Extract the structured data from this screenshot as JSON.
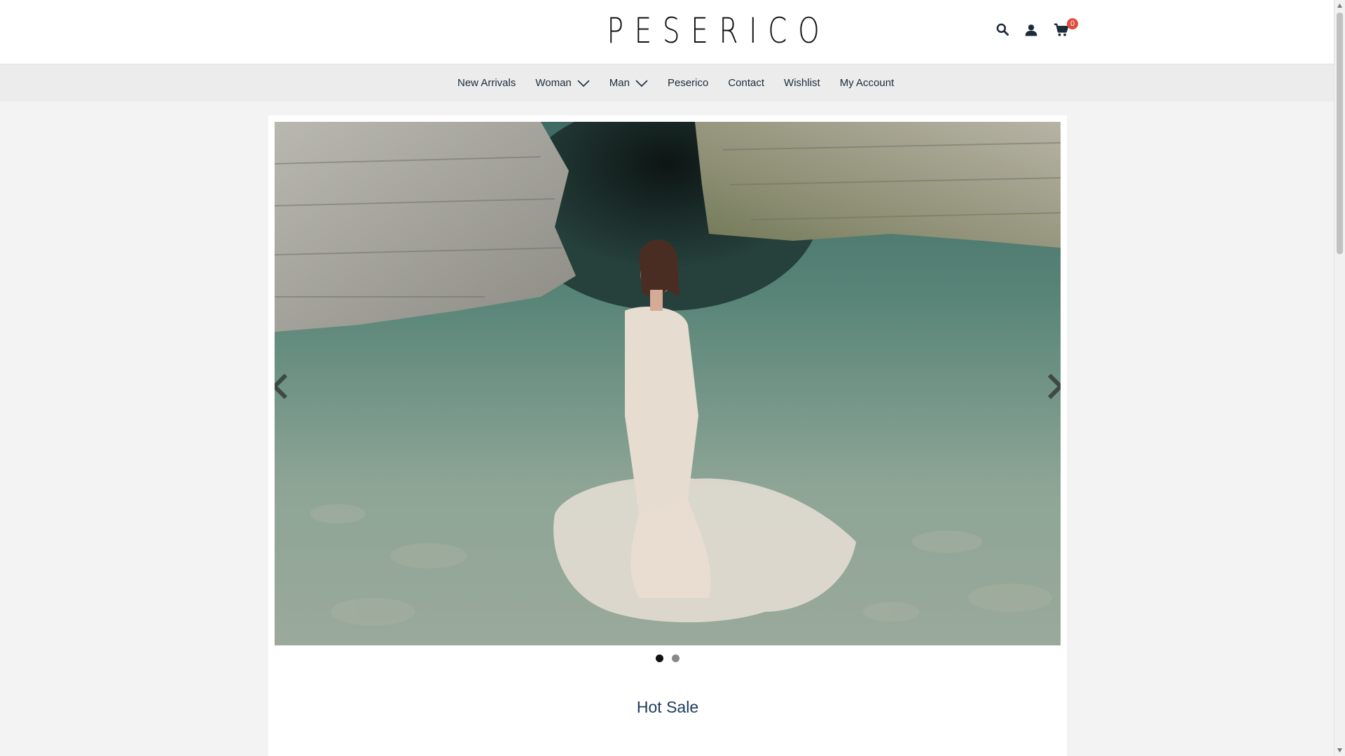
{
  "header": {
    "logo_text": "PESERICO",
    "icons": [
      "search-icon",
      "user-icon",
      "cart-icon"
    ],
    "cart_count": "0"
  },
  "nav": {
    "items": [
      {
        "label": "New Arrivals",
        "has_dropdown": false
      },
      {
        "label": "Woman",
        "has_dropdown": true
      },
      {
        "label": "Man",
        "has_dropdown": true
      },
      {
        "label": "Peserico",
        "has_dropdown": false
      },
      {
        "label": "Contact",
        "has_dropdown": false
      },
      {
        "label": "Wishlist",
        "has_dropdown": false
      },
      {
        "label": "My Account",
        "has_dropdown": false
      }
    ]
  },
  "slider": {
    "slide_count": 2,
    "active_slide": 1,
    "icons": [
      "chevron-left-icon",
      "chevron-right-icon"
    ]
  },
  "section": {
    "title": "Hot Sale"
  },
  "colors": {
    "nav_bg": "#ececec",
    "page_bg": "#f3f3f3",
    "text": "#1c2b3a",
    "badge": "#e04b3c"
  }
}
